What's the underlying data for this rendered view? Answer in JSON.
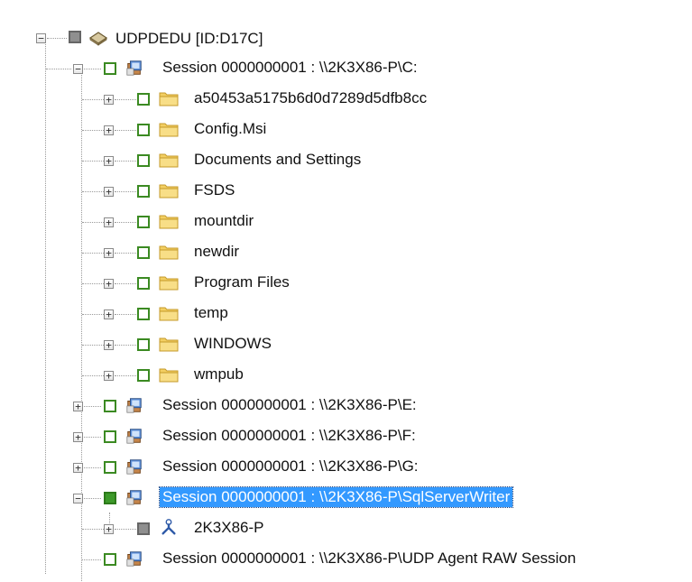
{
  "tree": {
    "root": {
      "label": "UDPDEDU [ID:D17C]",
      "icon": "node-disk-icon"
    },
    "session_c": {
      "label": "Session 0000000001 : \\\\2K3X86-P\\C:",
      "children": [
        "a50453a5175b6d0d7289d5dfb8cc",
        "Config.Msi",
        "Documents and Settings",
        "FSDS",
        "mountdir",
        "newdir",
        "Program Files",
        "temp",
        "WINDOWS",
        "wmpub"
      ]
    },
    "session_e": {
      "label": "Session 0000000001 : \\\\2K3X86-P\\E:"
    },
    "session_f": {
      "label": "Session 0000000001 : \\\\2K3X86-P\\F:"
    },
    "session_g": {
      "label": "Session 0000000001 : \\\\2K3X86-P\\G:"
    },
    "session_sql": {
      "label": "Session 0000000001 : \\\\2K3X86-P\\SqlServerWriter",
      "child": "2K3X86-P"
    },
    "session_raw": {
      "label": "Session 0000000001 : \\\\2K3X86-P\\UDP Agent RAW Session"
    }
  },
  "colors": {
    "selection_bg": "#3399ff",
    "check_green": "#3d9a2a",
    "folder_yellow": "#f3cf62"
  }
}
